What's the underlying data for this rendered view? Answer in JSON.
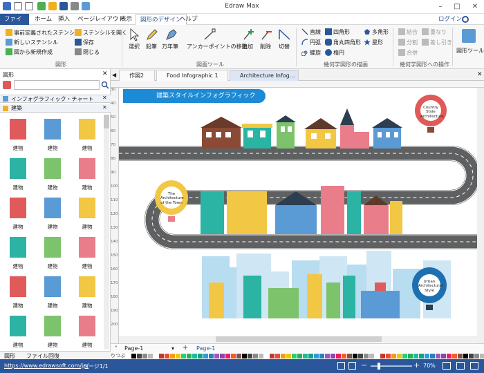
{
  "app": {
    "title": "Edraw Max",
    "login": "ログイン"
  },
  "menu": {
    "items": [
      "ファイル",
      "ホーム",
      "挿入",
      "ページレイアウト",
      "表示",
      "図形のデザイン",
      "ヘルプ"
    ],
    "active": "図形のデザイン"
  },
  "ribbon": {
    "shapes_group": {
      "label": "図形",
      "predefined": "事前定義されたステンシル",
      "new_stencil": "新しいステンシル",
      "new_from_shape": "図から新規作成",
      "open_stencil": "ステンシルを開く",
      "save": "保存",
      "close": "閉じる"
    },
    "tools_group": {
      "label": "図面ツール",
      "select": "選択",
      "pencil": "鉛筆",
      "pen": "万年筆",
      "anchor": "アンカーポイントの移動",
      "add": "追加",
      "delete": "削除",
      "cut": "切替"
    },
    "geometry_group": {
      "label": "幾何学図形の描画",
      "line": "直線",
      "arc": "円弧",
      "spiral": "螺旋",
      "rect": "四角形",
      "rounded_rect": "角丸四角形",
      "ellipse": "楕円",
      "polygon": "多角形",
      "star": "星形"
    },
    "ops_group": {
      "label": "幾何学図形への操作",
      "union": "結合",
      "overlap": "重なり",
      "split": "分割",
      "subtract": "差し引き",
      "merge": "合併"
    },
    "shape_tools": "図形ツール"
  },
  "left_panel": {
    "title": "図形",
    "search_placeholder": "",
    "categories": [
      "インフォグラフィック・チャート",
      "建築"
    ],
    "shape_label": "建物",
    "bottom_tabs": [
      "図形",
      "ファイル回復"
    ]
  },
  "tabs": [
    {
      "label": "作図2"
    },
    {
      "label": "Food Infographic 1"
    },
    {
      "label": "Architecture Infog..."
    }
  ],
  "canvas": {
    "banner": "建築スタイルインフォグラフィック",
    "balloons": [
      {
        "text": "Country Style Architecture",
        "color": "#e05a5a"
      },
      {
        "text": "The Architecture of the Town",
        "color": "#f2c744"
      },
      {
        "text": "Urban Architectural Style",
        "color": "#1e6fb0"
      }
    ],
    "ruler_left_ticks": [
      "30",
      "40",
      "50",
      "60",
      "70",
      "80",
      "90",
      "100",
      "110",
      "120",
      "130",
      "140",
      "150",
      "160",
      "170",
      "180",
      "190",
      "200"
    ]
  },
  "pagebar": {
    "page_select": "Page-1",
    "page_tab": "Page-1",
    "fill_label": "りつぶ"
  },
  "status": {
    "url": "https://www.edrawsoft.com/jp/",
    "page_info": "ページ1/1",
    "zoom": "70%"
  },
  "colors": {
    "accent": "#2b579a",
    "road": "#5f6062",
    "banner": "#1d8ad6"
  }
}
